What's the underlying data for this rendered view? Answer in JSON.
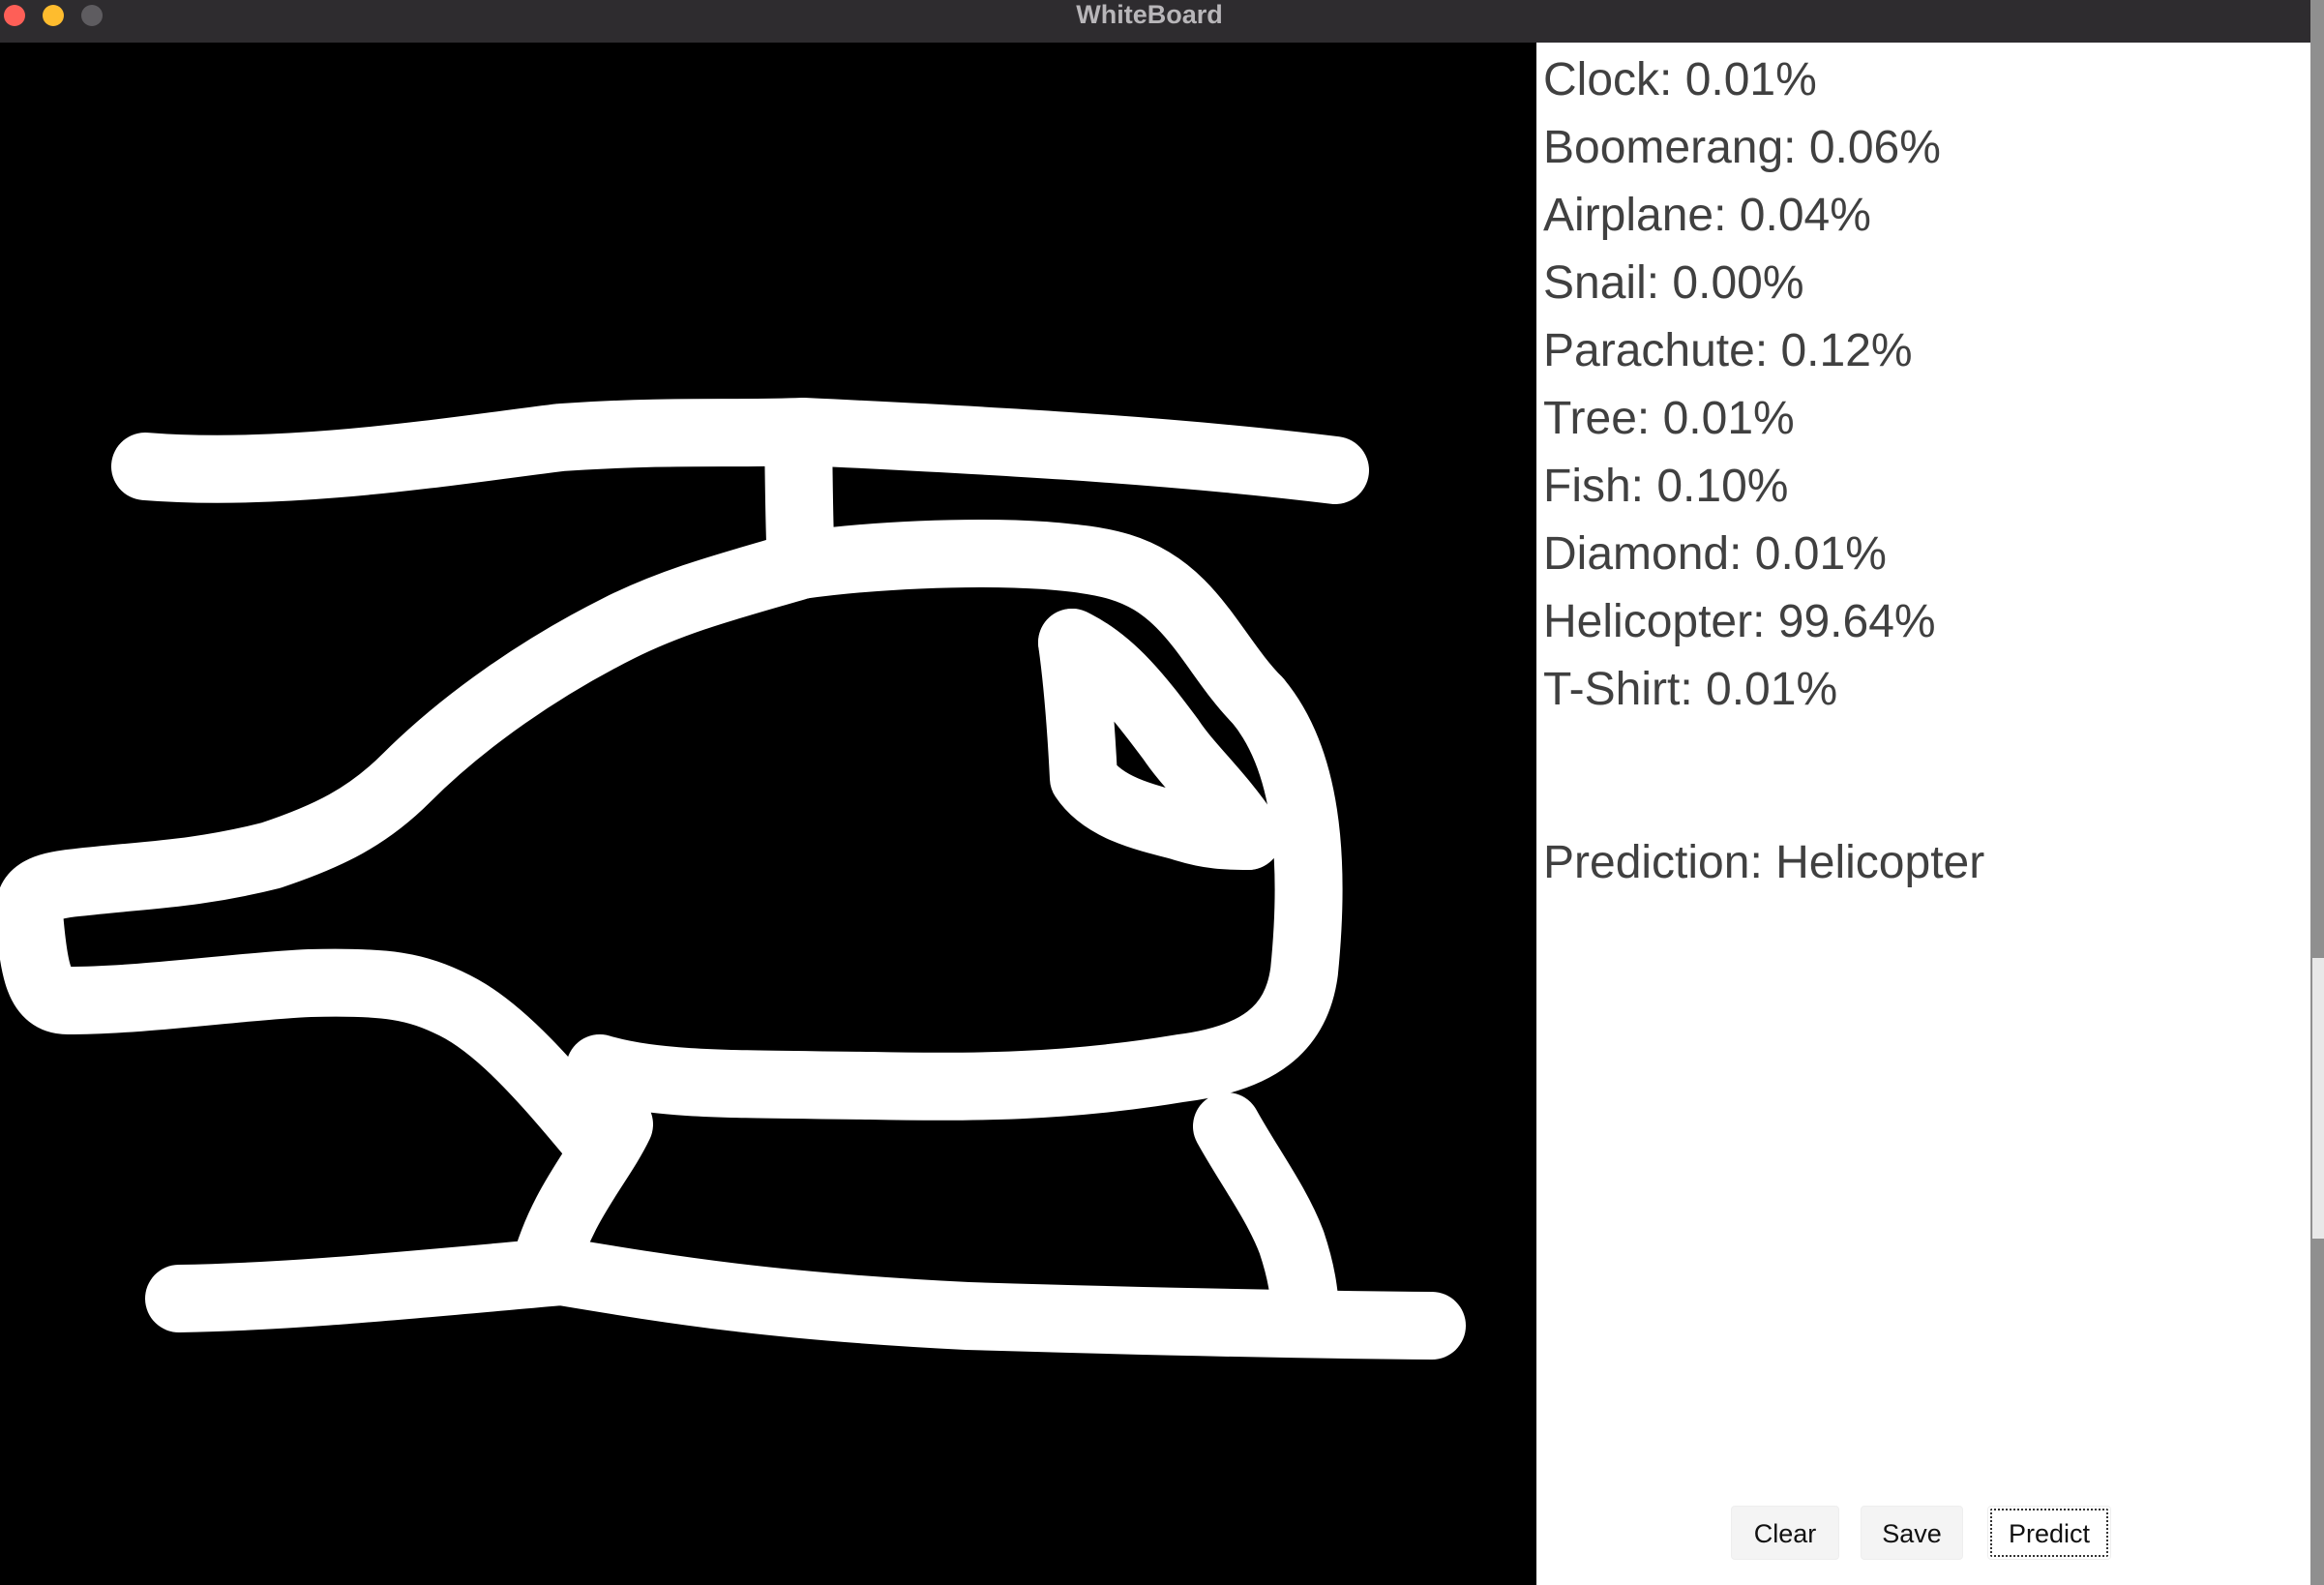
{
  "window": {
    "title": "WhiteBoard"
  },
  "probabilities": [
    {
      "label": "Clock: 0.01%",
      "class": "Clock",
      "percent": 0.01
    },
    {
      "label": "Boomerang: 0.06%",
      "class": "Boomerang",
      "percent": 0.06
    },
    {
      "label": "Airplane: 0.04%",
      "class": "Airplane",
      "percent": 0.04
    },
    {
      "label": "Snail: 0.00%",
      "class": "Snail",
      "percent": 0.0
    },
    {
      "label": "Parachute: 0.12%",
      "class": "Parachute",
      "percent": 0.12
    },
    {
      "label": "Tree: 0.01%",
      "class": "Tree",
      "percent": 0.01
    },
    {
      "label": "Fish: 0.10%",
      "class": "Fish",
      "percent": 0.1
    },
    {
      "label": "Diamond: 0.01%",
      "class": "Diamond",
      "percent": 0.01
    },
    {
      "label": "Helicopter: 99.64%",
      "class": "Helicopter",
      "percent": 99.64
    },
    {
      "label": "T-Shirt: 0.01%",
      "class": "T-Shirt",
      "percent": 0.01
    }
  ],
  "prediction": {
    "text": "Prediction: Helicopter"
  },
  "buttons": {
    "clear": "Clear",
    "save": "Save",
    "predict": "Predict"
  },
  "colors": {
    "canvas_bg": "#000000",
    "stroke": "#ffffff",
    "panel_bg": "#ffffff",
    "text": "#404040"
  },
  "icons": {
    "window_controls": [
      "close-dot",
      "minimize-dot",
      "maximize-dot"
    ]
  }
}
